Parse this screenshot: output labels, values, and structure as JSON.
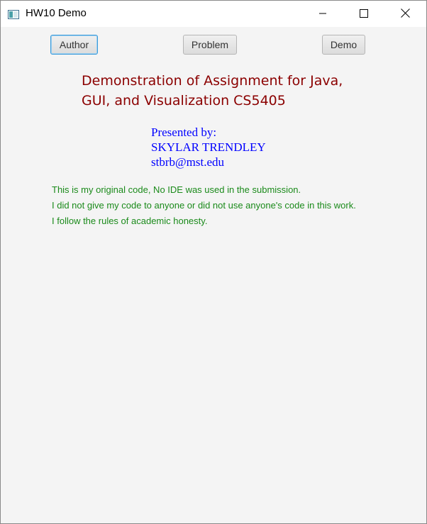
{
  "window": {
    "title": "HW10 Demo",
    "icon": "app-window-icon",
    "controls": [
      "minimize-icon",
      "maximize-icon",
      "close-icon"
    ]
  },
  "toolbar": {
    "author_label": "Author",
    "problem_label": "Problem",
    "demo_label": "Demo",
    "focused": "Author"
  },
  "heading": {
    "line1": "Demonstration of Assignment for Java,",
    "line2": "GUI, and Visualization CS5405",
    "color": "#8b0000"
  },
  "presenter": {
    "label": "Presented by:",
    "name": "SKYLAR TRENDLEY",
    "email": "stbrb@mst.edu",
    "color": "#0000ff"
  },
  "honesty": {
    "lines": [
      "This is my original code, No IDE was used in the submission.",
      "I did not give my code to anyone or did not use anyone's code in this work.",
      "I follow the rules of academic honesty."
    ],
    "color": "#1a8a1a"
  }
}
